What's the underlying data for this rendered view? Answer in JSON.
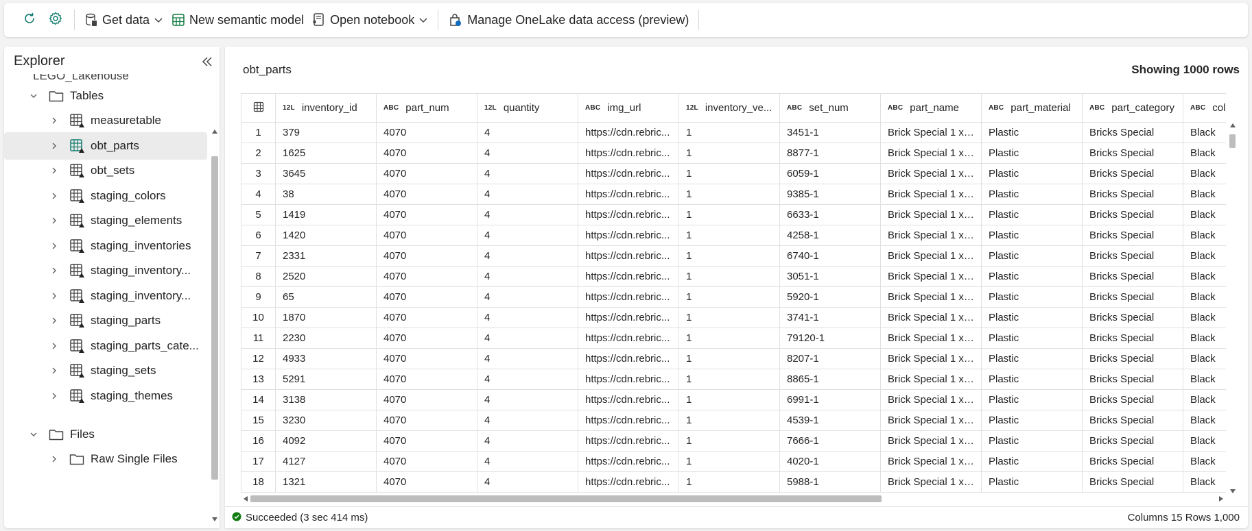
{
  "toolbar": {
    "refresh_icon": "refresh-icon",
    "settings_icon": "gear-icon",
    "get_data": "Get data",
    "new_semantic_model": "New semantic model",
    "open_notebook": "Open notebook",
    "manage_onelake": "Manage OneLake data access (preview)"
  },
  "explorer": {
    "title": "Explorer",
    "lakehouse_name": "LEGO_Lakehouse",
    "tables_label": "Tables",
    "tables": [
      {
        "label": "measuretable"
      },
      {
        "label": "obt_parts"
      },
      {
        "label": "obt_sets"
      },
      {
        "label": "staging_colors"
      },
      {
        "label": "staging_elements"
      },
      {
        "label": "staging_inventories"
      },
      {
        "label": "staging_inventory..."
      },
      {
        "label": "staging_inventory..."
      },
      {
        "label": "staging_parts"
      },
      {
        "label": "staging_parts_cate..."
      },
      {
        "label": "staging_sets"
      },
      {
        "label": "staging_themes"
      }
    ],
    "selected_table": "obt_parts",
    "files_label": "Files",
    "files": [
      {
        "label": "Raw Single Files"
      }
    ]
  },
  "main": {
    "table_name": "obt_parts",
    "row_count_label": "Showing 1000 rows",
    "columns": [
      {
        "type": "12L",
        "name": "inventory_id"
      },
      {
        "type": "ABC",
        "name": "part_num"
      },
      {
        "type": "12L",
        "name": "quantity"
      },
      {
        "type": "ABC",
        "name": "img_url"
      },
      {
        "type": "12L",
        "name": "inventory_ve..."
      },
      {
        "type": "ABC",
        "name": "set_num"
      },
      {
        "type": "ABC",
        "name": "part_name"
      },
      {
        "type": "ABC",
        "name": "part_material"
      },
      {
        "type": "ABC",
        "name": "part_category"
      },
      {
        "type": "ABC",
        "name": "colo"
      }
    ],
    "rows": [
      [
        "1",
        "379",
        "4070",
        "4",
        "https://cdn.rebric...",
        "1",
        "3451-1",
        "Brick Special 1 x ...",
        "Plastic",
        "Bricks Special",
        "Black"
      ],
      [
        "2",
        "1625",
        "4070",
        "4",
        "https://cdn.rebric...",
        "1",
        "8877-1",
        "Brick Special 1 x ...",
        "Plastic",
        "Bricks Special",
        "Black"
      ],
      [
        "3",
        "3645",
        "4070",
        "4",
        "https://cdn.rebric...",
        "1",
        "6059-1",
        "Brick Special 1 x ...",
        "Plastic",
        "Bricks Special",
        "Black"
      ],
      [
        "4",
        "38",
        "4070",
        "4",
        "https://cdn.rebric...",
        "1",
        "9385-1",
        "Brick Special 1 x ...",
        "Plastic",
        "Bricks Special",
        "Black"
      ],
      [
        "5",
        "1419",
        "4070",
        "4",
        "https://cdn.rebric...",
        "1",
        "6633-1",
        "Brick Special 1 x ...",
        "Plastic",
        "Bricks Special",
        "Black"
      ],
      [
        "6",
        "1420",
        "4070",
        "4",
        "https://cdn.rebric...",
        "1",
        "4258-1",
        "Brick Special 1 x ...",
        "Plastic",
        "Bricks Special",
        "Black"
      ],
      [
        "7",
        "2331",
        "4070",
        "4",
        "https://cdn.rebric...",
        "1",
        "6740-1",
        "Brick Special 1 x ...",
        "Plastic",
        "Bricks Special",
        "Black"
      ],
      [
        "8",
        "2520",
        "4070",
        "4",
        "https://cdn.rebric...",
        "1",
        "3051-1",
        "Brick Special 1 x ...",
        "Plastic",
        "Bricks Special",
        "Black"
      ],
      [
        "9",
        "65",
        "4070",
        "4",
        "https://cdn.rebric...",
        "1",
        "5920-1",
        "Brick Special 1 x ...",
        "Plastic",
        "Bricks Special",
        "Black"
      ],
      [
        "10",
        "1870",
        "4070",
        "4",
        "https://cdn.rebric...",
        "1",
        "3741-1",
        "Brick Special 1 x ...",
        "Plastic",
        "Bricks Special",
        "Black"
      ],
      [
        "11",
        "2230",
        "4070",
        "4",
        "https://cdn.rebric...",
        "1",
        "79120-1",
        "Brick Special 1 x ...",
        "Plastic",
        "Bricks Special",
        "Black"
      ],
      [
        "12",
        "4933",
        "4070",
        "4",
        "https://cdn.rebric...",
        "1",
        "8207-1",
        "Brick Special 1 x ...",
        "Plastic",
        "Bricks Special",
        "Black"
      ],
      [
        "13",
        "5291",
        "4070",
        "4",
        "https://cdn.rebric...",
        "1",
        "8865-1",
        "Brick Special 1 x ...",
        "Plastic",
        "Bricks Special",
        "Black"
      ],
      [
        "14",
        "3138",
        "4070",
        "4",
        "https://cdn.rebric...",
        "1",
        "6991-1",
        "Brick Special 1 x ...",
        "Plastic",
        "Bricks Special",
        "Black"
      ],
      [
        "15",
        "3230",
        "4070",
        "4",
        "https://cdn.rebric...",
        "1",
        "4539-1",
        "Brick Special 1 x ...",
        "Plastic",
        "Bricks Special",
        "Black"
      ],
      [
        "16",
        "4092",
        "4070",
        "4",
        "https://cdn.rebric...",
        "1",
        "7666-1",
        "Brick Special 1 x ...",
        "Plastic",
        "Bricks Special",
        "Black"
      ],
      [
        "17",
        "4127",
        "4070",
        "4",
        "https://cdn.rebric...",
        "1",
        "4020-1",
        "Brick Special 1 x ...",
        "Plastic",
        "Bricks Special",
        "Black"
      ],
      [
        "18",
        "1321",
        "4070",
        "4",
        "https://cdn.rebric...",
        "1",
        "5988-1",
        "Brick Special 1 x ...",
        "Plastic",
        "Bricks Special",
        "Black"
      ]
    ]
  },
  "status": {
    "message": "Succeeded (3 sec 414 ms)",
    "summary": "Columns 15 Rows 1,000",
    "success_color": "#107c10"
  },
  "colors": {
    "accent": "#0f6f6f",
    "selected_bg": "#ebebeb"
  }
}
